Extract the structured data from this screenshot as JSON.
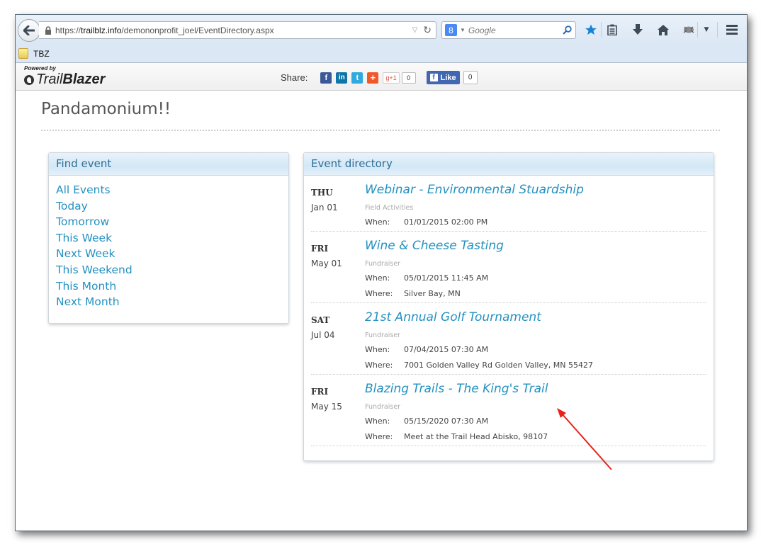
{
  "browser": {
    "url_prefix": "https://",
    "url_host": "trailblz.info",
    "url_path": "/demononprofit_joel/EventDirectory.aspx",
    "search_placeholder": "Google",
    "toolbar_icons": [
      "back-icon",
      "lock-icon",
      "dropdown-icon",
      "reload-icon",
      "google-icon",
      "search-icon",
      "bookmark-star-icon",
      "reading-list-icon",
      "download-icon",
      "home-icon",
      "extension-icon",
      "menu-icon"
    ],
    "bookmarks": [
      {
        "label": "TBZ",
        "icon": "folder-icon"
      }
    ]
  },
  "site_header": {
    "powered_by": "Powered by",
    "logo_trail": "Trail",
    "logo_blazer": "Blazer",
    "share_label": "Share:",
    "share_buttons": [
      {
        "name": "facebook",
        "glyph": "f",
        "color": "#3b5998"
      },
      {
        "name": "linkedin",
        "glyph": "in",
        "color": "#0e76a8"
      },
      {
        "name": "twitter",
        "glyph": "t",
        "color": "#2fa9e0"
      },
      {
        "name": "addthis",
        "glyph": "+",
        "color": "#f05a28"
      }
    ],
    "gplus_label": "g+1",
    "gplus_count": "0",
    "fb_like_label": "Like",
    "fb_like_count": "0"
  },
  "page": {
    "title": "Pandamonium!!"
  },
  "find_event": {
    "heading": "Find event",
    "links": [
      "All Events",
      "Today",
      "Tomorrow",
      "This Week",
      "Next Week",
      "This Weekend",
      "This Month",
      "Next Month"
    ]
  },
  "directory": {
    "heading": "Event directory",
    "when_label": "When:",
    "where_label": "Where:",
    "events": [
      {
        "dow": "THU",
        "date": "Jan 01",
        "title": "Webinar - Environmental Stuardship",
        "category": "Field Activities",
        "when": "01/01/2015 02:00 PM",
        "where": null
      },
      {
        "dow": "FRI",
        "date": "May 01",
        "title": "Wine & Cheese Tasting",
        "category": "Fundraiser",
        "when": "05/01/2015 11:45 AM",
        "where": "Silver Bay, MN"
      },
      {
        "dow": "SAT",
        "date": "Jul 04",
        "title": "21st Annual Golf Tournament",
        "category": "Fundraiser",
        "when": "07/04/2015 07:30 AM",
        "where": "7001 Golden Valley Rd Golden Valley, MN 55427"
      },
      {
        "dow": "FRI",
        "date": "May 15",
        "title": "Blazing Trails - The King's Trail",
        "category": "Fundraiser",
        "when": "05/15/2020 07:30 AM",
        "where": "Meet at the Trail Head Abisko, 98107"
      }
    ]
  },
  "annotation": {
    "color": "#e8241a",
    "type": "arrow",
    "points_to": "Blazing Trails - The King's Trail"
  }
}
